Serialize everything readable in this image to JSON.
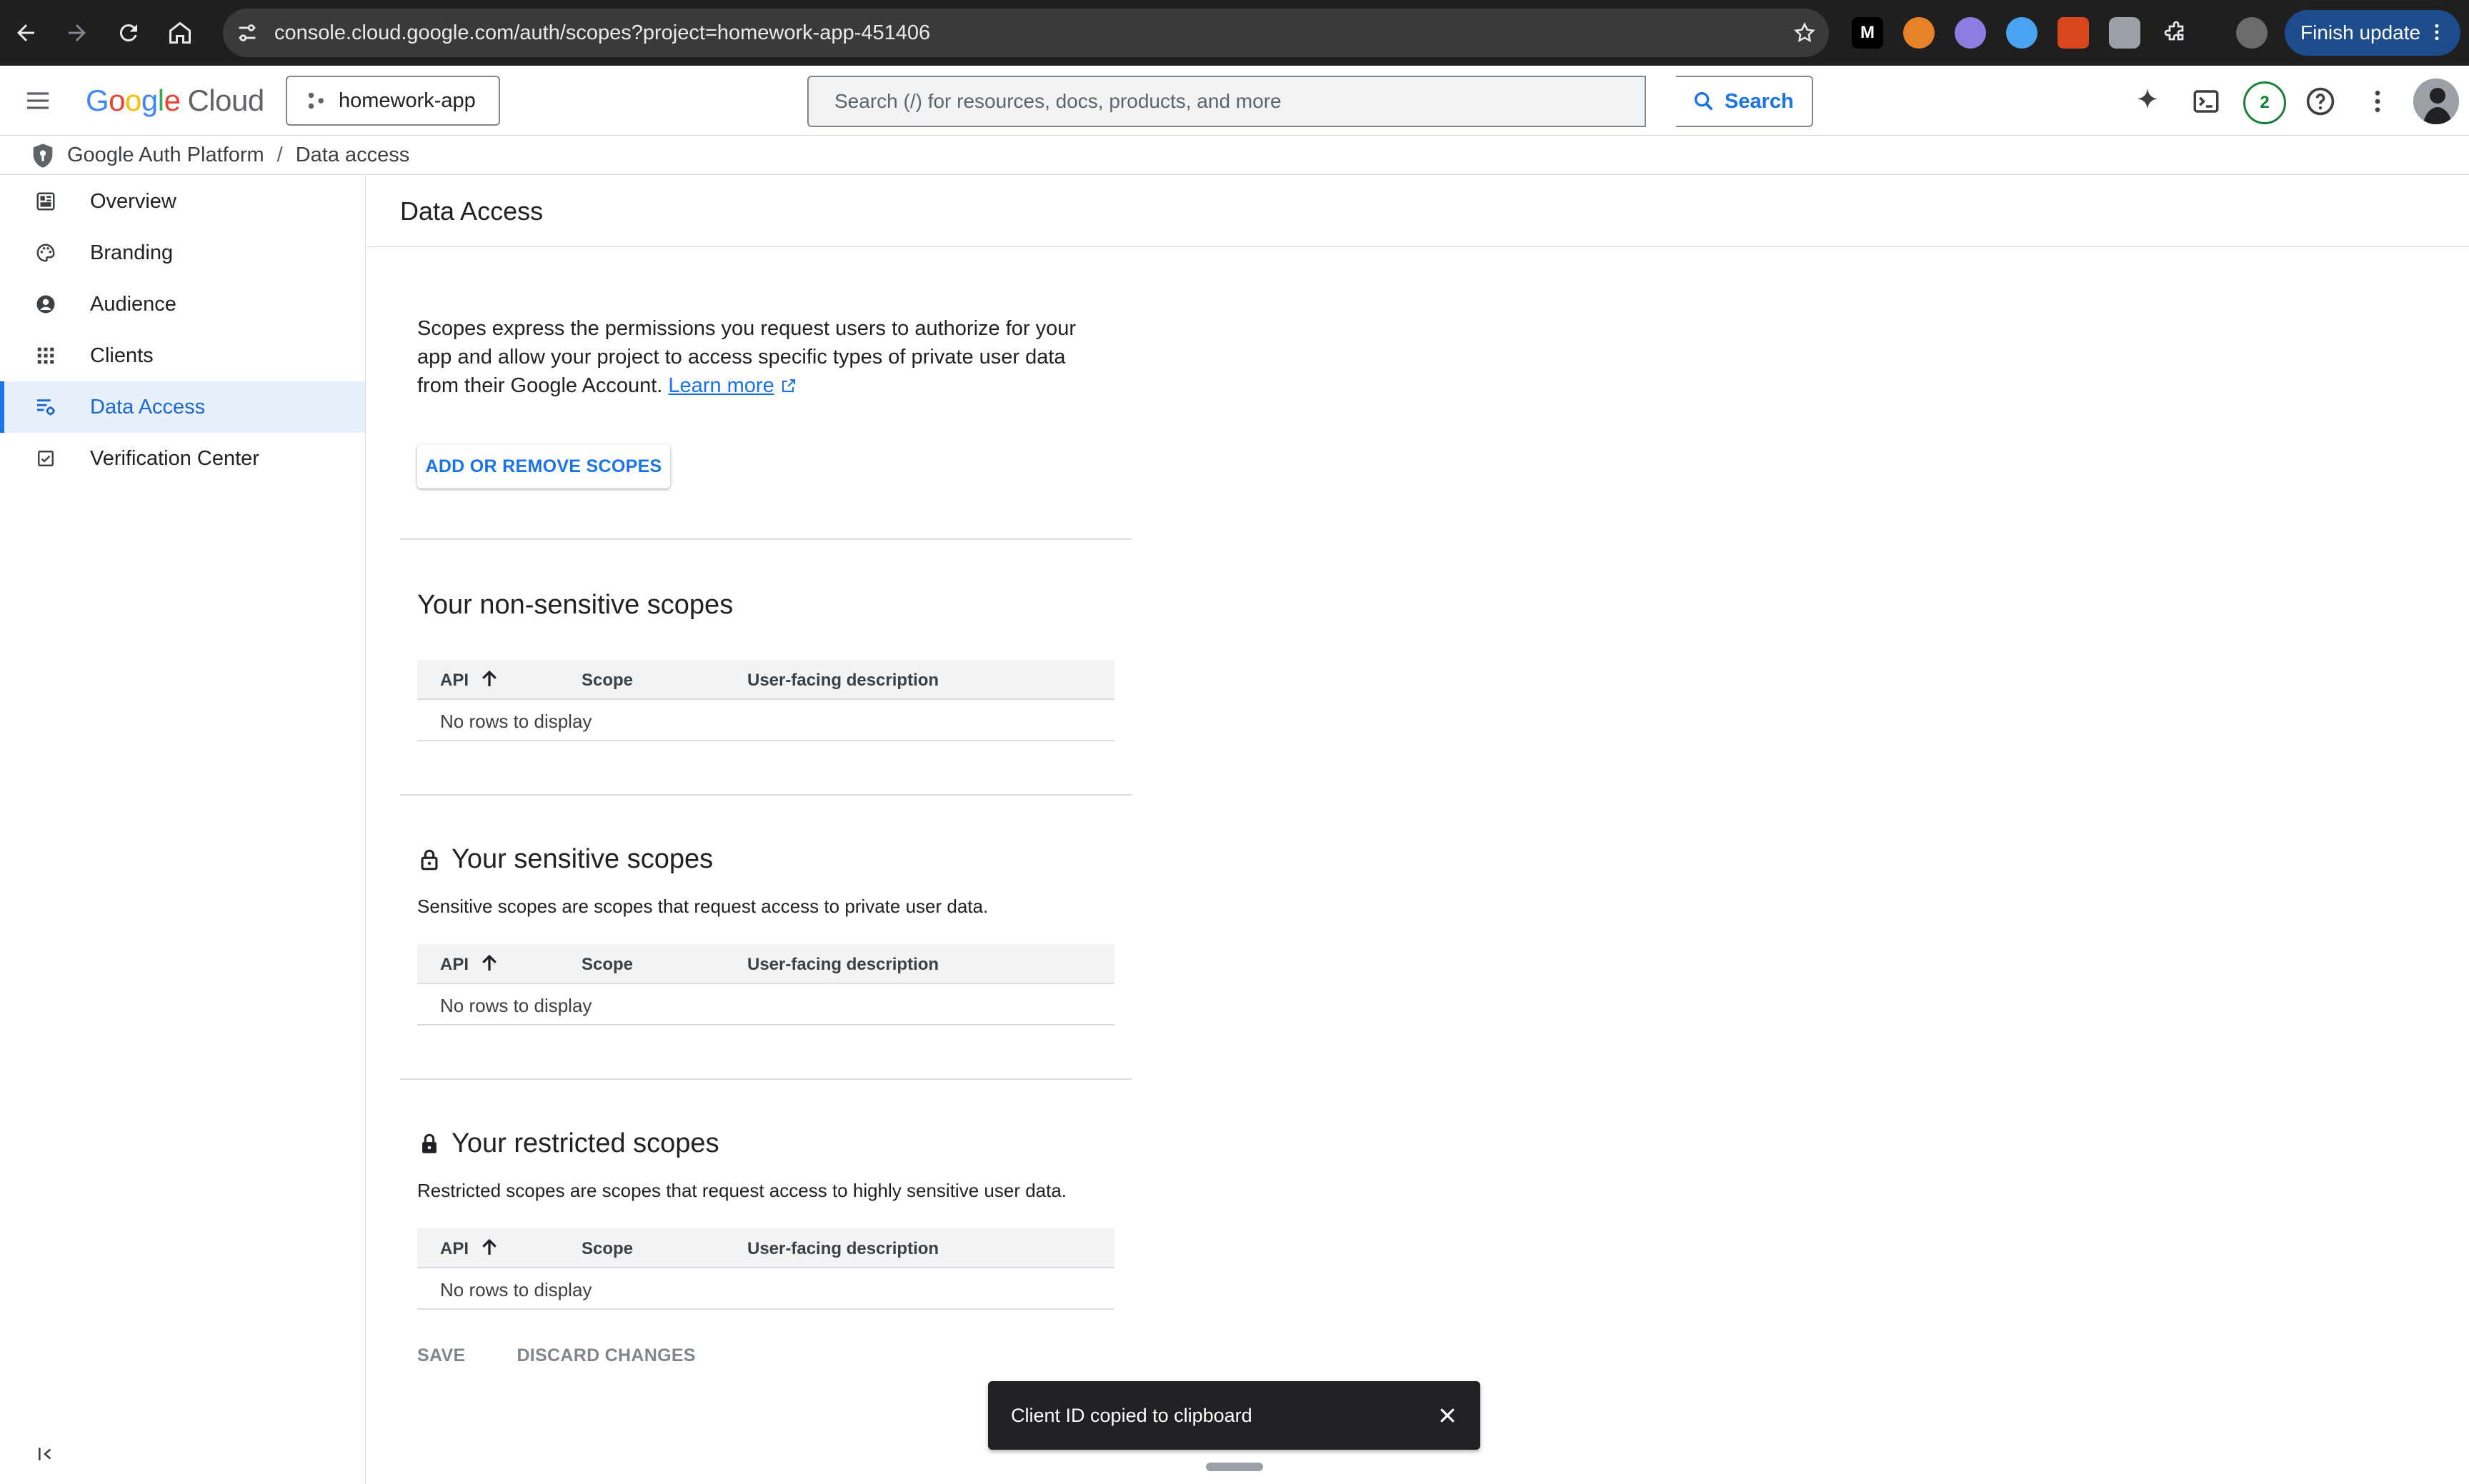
{
  "browser": {
    "url": "console.cloud.google.com/auth/scopes?project=homework-app-451406",
    "finish_update_label": "Finish update",
    "extensions": [
      "m-extension-icon",
      "fox-extension-icon",
      "ghost-extension-icon",
      "feather-extension-icon",
      "red-extension-icon",
      "camera-extension-icon",
      "puzzle-extensions-icon"
    ]
  },
  "appbar": {
    "logo_google": "Google",
    "logo_cloud": "Cloud",
    "project": "homework-app",
    "search_placeholder": "Search (/) for resources, docs, products, and more",
    "search_button": "Search",
    "notification_count": "2"
  },
  "breadcrumb": {
    "root": "Google Auth Platform",
    "separator": "/",
    "current": "Data access"
  },
  "sidebar": {
    "items": [
      {
        "label": "Overview",
        "icon": "dashboard-icon"
      },
      {
        "label": "Branding",
        "icon": "palette-icon"
      },
      {
        "label": "Audience",
        "icon": "person-icon"
      },
      {
        "label": "Clients",
        "icon": "grid-icon"
      },
      {
        "label": "Data Access",
        "icon": "data-access-icon",
        "active": true
      },
      {
        "label": "Verification Center",
        "icon": "checkbox-icon"
      }
    ]
  },
  "page": {
    "title": "Data Access",
    "intro": "Scopes express the permissions you request users to authorize for your app and allow your project to access specific types of private user data from their Google Account.",
    "learn_more": "Learn more",
    "add_scopes_button": "ADD OR REMOVE SCOPES",
    "table_headers": {
      "api": "API",
      "scope": "Scope",
      "description": "User-facing description"
    },
    "empty_text": "No rows to display",
    "sections": {
      "non_sensitive": {
        "title": "Your non-sensitive scopes"
      },
      "sensitive": {
        "title": "Your sensitive scopes",
        "description": "Sensitive scopes are scopes that request access to private user data."
      },
      "restricted": {
        "title": "Your restricted scopes",
        "description": "Restricted scopes are scopes that request access to highly sensitive user data."
      }
    },
    "save_button": "SAVE",
    "discard_button": "DISCARD CHANGES"
  },
  "snackbar": {
    "message": "Client ID copied to clipboard"
  },
  "colors": {
    "accent": "#1a73e8",
    "active_bg": "#e8f0fe",
    "chrome_bg": "#1f1f1f",
    "snackbar_bg": "#202124"
  }
}
